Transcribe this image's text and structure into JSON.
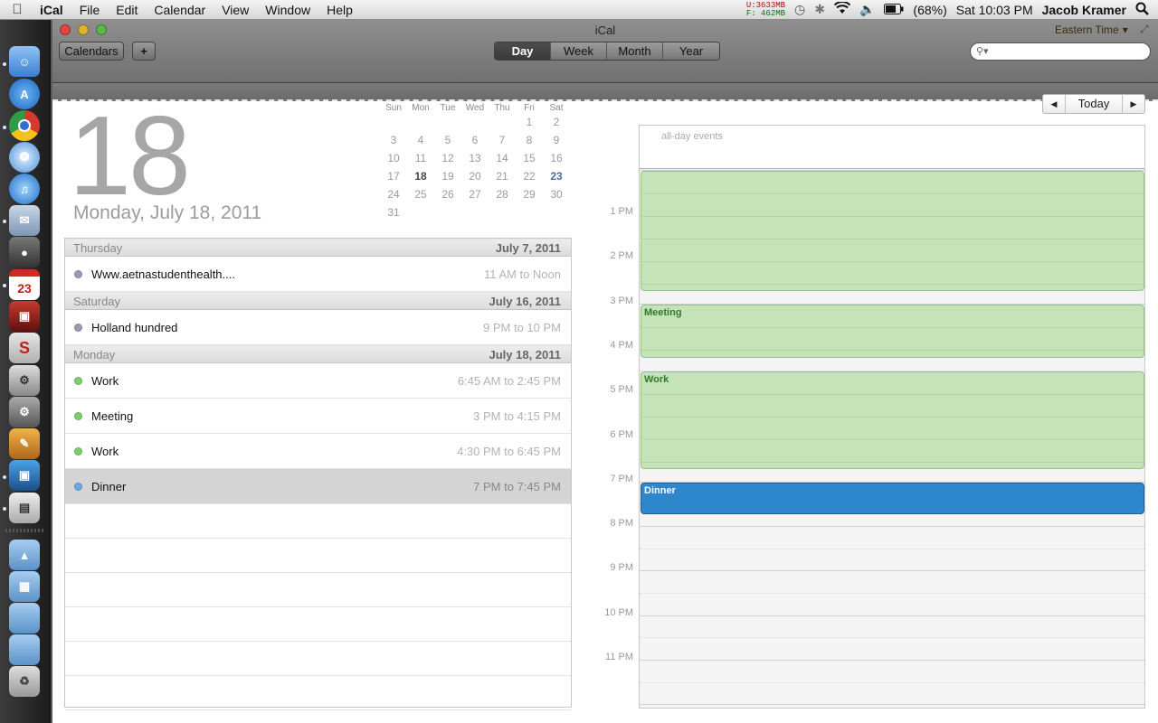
{
  "menubar": {
    "app_name": "iCal",
    "menus": [
      "File",
      "Edit",
      "Calendar",
      "View",
      "Window",
      "Help"
    ],
    "memory_used": "U:3633MB",
    "memory_free": "F: 462MB",
    "battery": "(68%)",
    "clock": "Sat 10:03 PM",
    "user": "Jacob Kramer"
  },
  "window": {
    "title": "iCal",
    "calendars_button": "Calendars",
    "add_button": "+",
    "views": [
      "Day",
      "Week",
      "Month",
      "Year"
    ],
    "active_view": "Day",
    "timezone": "Eastern Time",
    "search_placeholder": ""
  },
  "date": {
    "day_number": "18",
    "full_date": "Monday, July 18, 2011"
  },
  "mini_calendar": {
    "weekdays": [
      "Sun",
      "Mon",
      "Tue",
      "Wed",
      "Thu",
      "Fri",
      "Sat"
    ],
    "weeks": [
      [
        "",
        "",
        "",
        "",
        "",
        "1",
        "2"
      ],
      [
        "3",
        "4",
        "5",
        "6",
        "7",
        "8",
        "9"
      ],
      [
        "10",
        "11",
        "12",
        "13",
        "14",
        "15",
        "16"
      ],
      [
        "17",
        "18",
        "19",
        "20",
        "21",
        "22",
        "23"
      ],
      [
        "24",
        "25",
        "26",
        "27",
        "28",
        "29",
        "30"
      ],
      [
        "31",
        "",
        "",
        "",
        "",
        "",
        ""
      ]
    ],
    "today": "18",
    "highlight": "23"
  },
  "event_list": [
    {
      "day": "Thursday",
      "date": "July 7, 2011",
      "events": [
        {
          "title": "Www.aetnastudenthealth....",
          "time": "11 AM to Noon",
          "color": "#9a9ab0",
          "selected": false
        }
      ]
    },
    {
      "day": "Saturday",
      "date": "July 16, 2011",
      "events": [
        {
          "title": "Holland hundred",
          "time": "9 PM to 10 PM",
          "color": "#9a9ab0",
          "selected": false
        }
      ]
    },
    {
      "day": "Monday",
      "date": "July 18, 2011",
      "events": [
        {
          "title": "Work",
          "time": "6:45 AM to 2:45 PM",
          "color": "#7ccf6a",
          "selected": false
        },
        {
          "title": "Meeting",
          "time": "3 PM to 4:15 PM",
          "color": "#7ccf6a",
          "selected": false
        },
        {
          "title": "Work",
          "time": "4:30 PM to 6:45 PM",
          "color": "#7ccf6a",
          "selected": false
        },
        {
          "title": "Dinner",
          "time": "7 PM to 7:45 PM",
          "color": "#6aa8e0",
          "selected": true
        }
      ]
    }
  ],
  "day_view": {
    "today_button": "Today",
    "all_day_label": "all-day events",
    "hour_labels": [
      "1 PM",
      "2 PM",
      "3 PM",
      "4 PM",
      "5 PM",
      "6 PM",
      "7 PM",
      "8 PM",
      "9 PM",
      "10 PM",
      "11 PM"
    ],
    "events": [
      {
        "title": "",
        "start_hour": 12.0,
        "end_hour": 14.75,
        "style": "green"
      },
      {
        "title": "Meeting",
        "start_hour": 15.0,
        "end_hour": 16.25,
        "style": "green"
      },
      {
        "title": "Work",
        "start_hour": 16.5,
        "end_hour": 18.75,
        "style": "green"
      },
      {
        "title": "Dinner",
        "start_hour": 19.0,
        "end_hour": 19.75,
        "style": "blue"
      }
    ]
  },
  "colors": {
    "work_green": "#c5e3b8",
    "dinner_blue": "#2e86cc"
  }
}
